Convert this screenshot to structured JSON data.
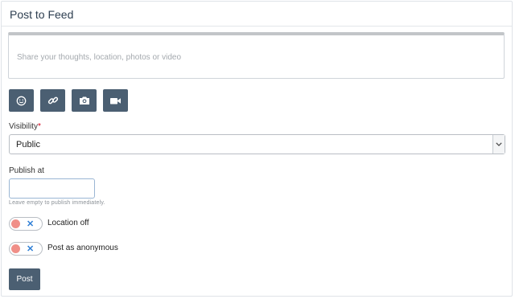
{
  "panel": {
    "title": "Post to Feed"
  },
  "composer": {
    "placeholder": "Share your thoughts, location, photos or video",
    "value": ""
  },
  "toolbar": {
    "buttons": [
      "smiley-icon",
      "link-icon",
      "camera-icon",
      "video-icon"
    ]
  },
  "visibility": {
    "label": "Visibility",
    "required_mark": "*",
    "selected": "Public"
  },
  "publish": {
    "label": "Publish at",
    "value": "",
    "hint": "Leave empty to publish immediately."
  },
  "toggles": {
    "location": {
      "label": "Location off",
      "state": "off"
    },
    "anonymous": {
      "label": "Post as anonymous",
      "state": "off"
    }
  },
  "actions": {
    "post_label": "Post"
  },
  "colors": {
    "button_bg": "#4b5f72",
    "toggle_off_knob": "#f08f88",
    "toggle_x": "#2f7fd6",
    "required": "#d0021b"
  }
}
